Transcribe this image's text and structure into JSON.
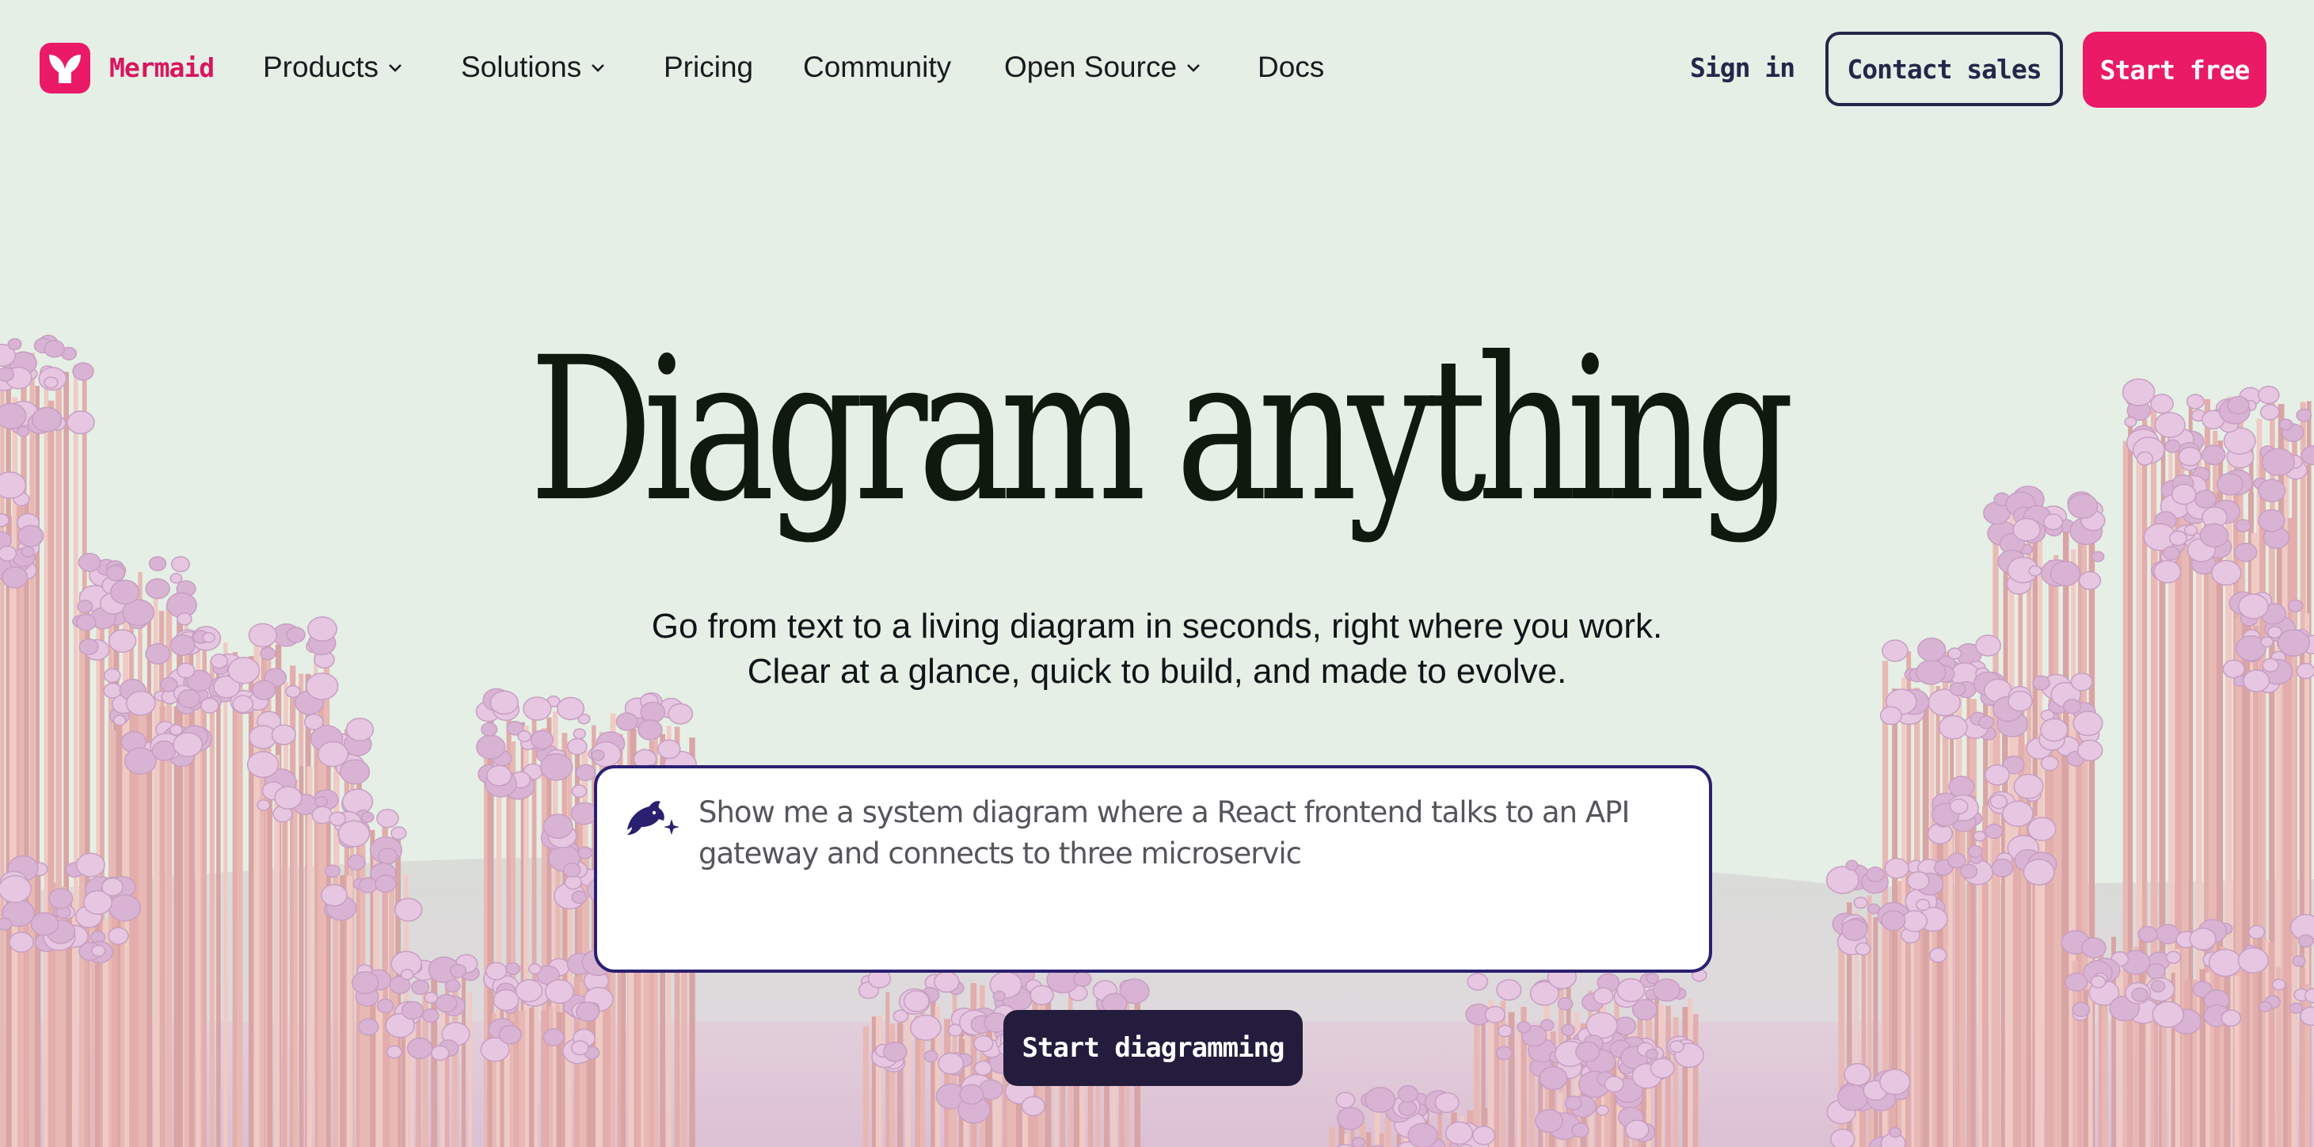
{
  "brand": {
    "name": "Mermaid",
    "logo_icon": "mermaid-logo-icon",
    "color": "#ea1a66"
  },
  "nav": {
    "items": [
      {
        "label": "Products",
        "has_dropdown": true
      },
      {
        "label": "Solutions",
        "has_dropdown": true
      },
      {
        "label": "Pricing",
        "has_dropdown": false
      },
      {
        "label": "Community",
        "has_dropdown": false
      },
      {
        "label": "Open Source",
        "has_dropdown": true
      },
      {
        "label": "Docs",
        "has_dropdown": false
      }
    ],
    "sign_in": "Sign in",
    "contact_sales": "Contact sales",
    "start_free": "Start free"
  },
  "hero": {
    "title": "Diagram anything",
    "subtitle_line1": "Go from text to a living diagram in seconds, right where you work.",
    "subtitle_line2": "Clear at a glance, quick to build, and made to evolve."
  },
  "prompt": {
    "icon": "dolphin-sparkle-icon",
    "text": "Show me a system diagram where a React frontend talks to an API gateway and connects to three microservic"
  },
  "cta": {
    "label": "Start diagramming"
  },
  "colors": {
    "background": "#e5efe5",
    "accent": "#ea1a66",
    "navy": "#23284a",
    "cta_dark": "#231c3c",
    "prompt_border": "#2a2070"
  }
}
